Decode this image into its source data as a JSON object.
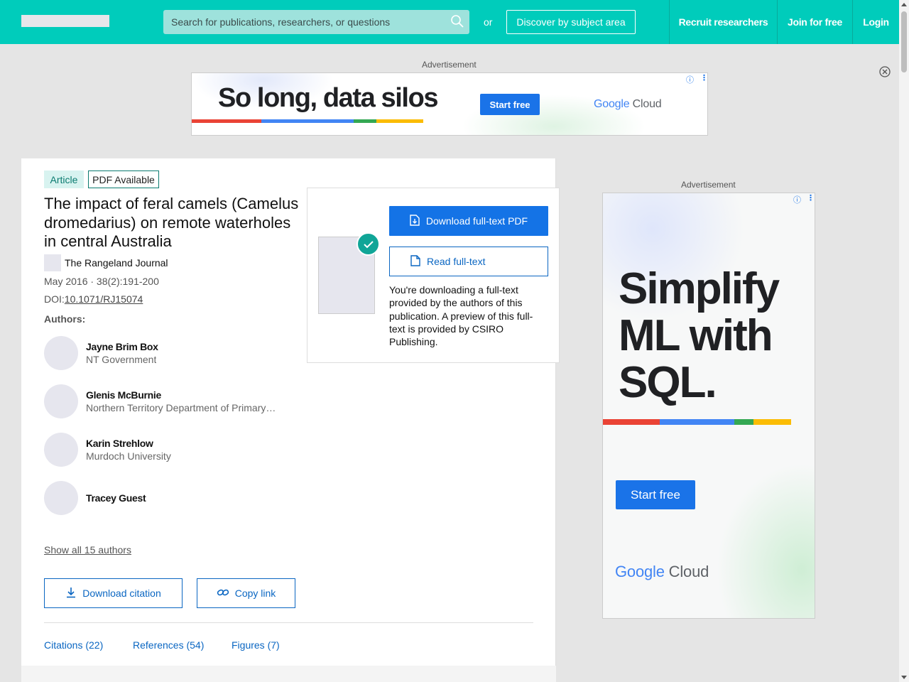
{
  "header": {
    "search_placeholder": "Search for publications, researchers, or questions",
    "or_label": "or",
    "discover_label": "Discover by subject area",
    "nav": [
      "Recruit researchers",
      "Join for free",
      "Login"
    ]
  },
  "ads": {
    "label": "Advertisement",
    "top": {
      "headline": "So long, data silos",
      "cta": "Start free",
      "brand_google": "Google",
      "brand_cloud": "Cloud"
    },
    "side": {
      "headline_lines": [
        "Simplify",
        "ML with",
        "SQL."
      ],
      "cta": "Start free",
      "brand_google": "Google",
      "brand_cloud": "Cloud"
    }
  },
  "article": {
    "type_badge": "Article",
    "pdf_badge": "PDF Available",
    "title": "The impact of feral camels (Camelus dromedarius) on remote waterholes in central Australia",
    "journal": "The Rangeland Journal",
    "meta": "May 2016 · 38(2):191-200",
    "doi_prefix": "DOI:",
    "doi": "10.1071/RJ15074",
    "authors_label": "Authors:",
    "authors": [
      {
        "name": "Jayne Brim Box",
        "affiliation": "NT Government"
      },
      {
        "name": "Glenis McBurnie",
        "affiliation": "Northern Territory Department of Primary …"
      },
      {
        "name": "Karin Strehlow",
        "affiliation": "Murdoch University"
      },
      {
        "name": "Tracey Guest",
        "affiliation": ""
      }
    ],
    "show_all": "Show all 15 authors",
    "download_citation": "Download citation",
    "copy_link": "Copy link",
    "tabs": [
      "Citations (22)",
      "References (54)",
      "Figures (7)"
    ]
  },
  "download_popup": {
    "download_pdf": "Download full-text PDF",
    "read_fulltext": "Read full-text",
    "note": "You're downloading a full-text provided by the authors of this publication. A preview of this full-text is provided by CSIRO Publishing."
  },
  "colors": {
    "header_bg": "#00ccbb",
    "primary_blue": "#1473e6",
    "link_blue": "#0a66c2",
    "check_green": "#10a597",
    "google_red": "#ea4335",
    "google_blue": "#4285f4",
    "google_green": "#34a853",
    "google_yellow": "#fbbc04"
  }
}
